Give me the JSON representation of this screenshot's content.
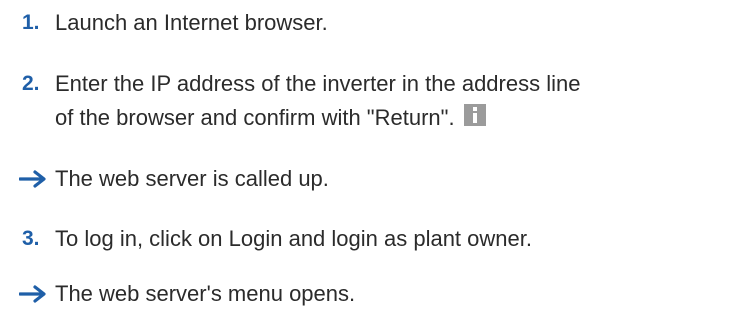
{
  "steps": [
    {
      "number": "1.",
      "text": "Launch an Internet browser."
    },
    {
      "number": "2.",
      "text_line1": "Enter the IP address of the inverter in the address line",
      "text_line2": "of the browser and confirm with \"Return\".",
      "icon": "info-icon"
    },
    {
      "number": "3.",
      "text": "To log in, click on Login and login as plant owner."
    }
  ],
  "results": [
    {
      "icon": "arrow-right-icon",
      "text": "The web server is called up."
    },
    {
      "icon": "arrow-right-icon",
      "text": "The web server's menu opens."
    }
  ],
  "colors": {
    "accent": "#1f5fa8",
    "text": "#2b2b2b",
    "icon_gray": "#9b9b9b"
  }
}
